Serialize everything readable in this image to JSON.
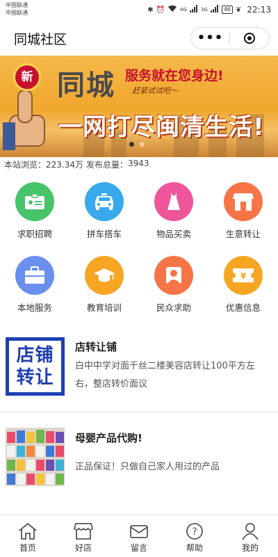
{
  "status_bar": {
    "carrier_1": "中国联通",
    "carrier_2": "中国联通",
    "network_1": "4G",
    "network_2": "3G",
    "battery": "46",
    "time": "22:13"
  },
  "nav": {
    "title": "同城社区",
    "more_label": "•••"
  },
  "banner": {
    "badge": "新",
    "headline": "同城",
    "tagline": "服务就在您身边!",
    "signature": "赶紧试试吧～",
    "slogan": "一网打尽闽清生活!",
    "slides": 2,
    "active_slide": 0
  },
  "stats": {
    "views_label": "本站浏览：",
    "views_value": "223.34万",
    "posts_label": "发布总量：",
    "posts_value": "3943"
  },
  "categories": [
    {
      "label": "求职招聘",
      "color": "#47c36a",
      "icon": "id-card-icon"
    },
    {
      "label": "拼车搭车",
      "color": "#38a9ec",
      "icon": "car-icon"
    },
    {
      "label": "物品买卖",
      "color": "#f0559b",
      "icon": "dress-icon"
    },
    {
      "label": "生意转让",
      "color": "#f77447",
      "icon": "shop-icon"
    },
    {
      "label": "本地服务",
      "color": "#6b8fef",
      "icon": "toolbox-icon"
    },
    {
      "label": "教育培训",
      "color": "#f6a623",
      "icon": "graduation-cap-icon"
    },
    {
      "label": "民众求助",
      "color": "#f77447",
      "icon": "person-card-icon"
    },
    {
      "label": "优惠信息",
      "color": "#f6a623",
      "icon": "coupon-icon"
    }
  ],
  "posts": [
    {
      "title": "店转让铺",
      "description": "白中中学对面千丝二楼美容店转让100平方左右，整店转价面议",
      "image_text": [
        "店铺",
        "转让"
      ]
    },
    {
      "title": "母婴产品代购!",
      "description": "正品保证！只做自己家人用过的产品"
    }
  ],
  "tabs": [
    {
      "label": "首页",
      "icon": "home-icon"
    },
    {
      "label": "好店",
      "icon": "store-icon"
    },
    {
      "label": "留言",
      "icon": "mail-icon"
    },
    {
      "label": "帮助",
      "icon": "help-icon"
    },
    {
      "label": "我的",
      "icon": "user-icon"
    }
  ]
}
